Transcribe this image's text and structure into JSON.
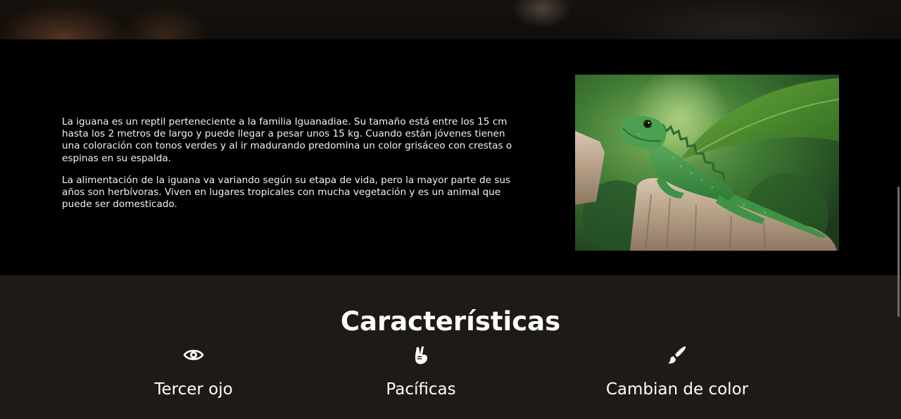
{
  "about": {
    "paragraphs": [
      "La iguana es un reptil perteneciente a la familia Iguanadiae. Su tamaño está entre los 15 cm hasta los 2 metros de largo y puede llegar a pesar unos 15 kg. Cuando están jóvenes tienen una coloración con tonos verdes y al ir madurando predomina un color grisáceo con crestas o espinas en su espalda.",
      "La alimentación de la iguana va variando según su etapa de vida, pero la mayor parte de sus años son herbívoras. Viven en lugares tropicales con mucha vegetación y es un animal que puede ser domesticado."
    ]
  },
  "features": {
    "title": "Características",
    "items": [
      {
        "label": "Tercer ojo",
        "icon": "eye-icon"
      },
      {
        "label": "Pacíficas",
        "icon": "peace-hand-icon"
      },
      {
        "label": "Cambian de color",
        "icon": "paintbrush-icon"
      }
    ]
  },
  "colors": {
    "background": "#000000",
    "features_background": "#1e1b17",
    "text": "#ffffff",
    "iguana_green": "#3f8f45"
  }
}
